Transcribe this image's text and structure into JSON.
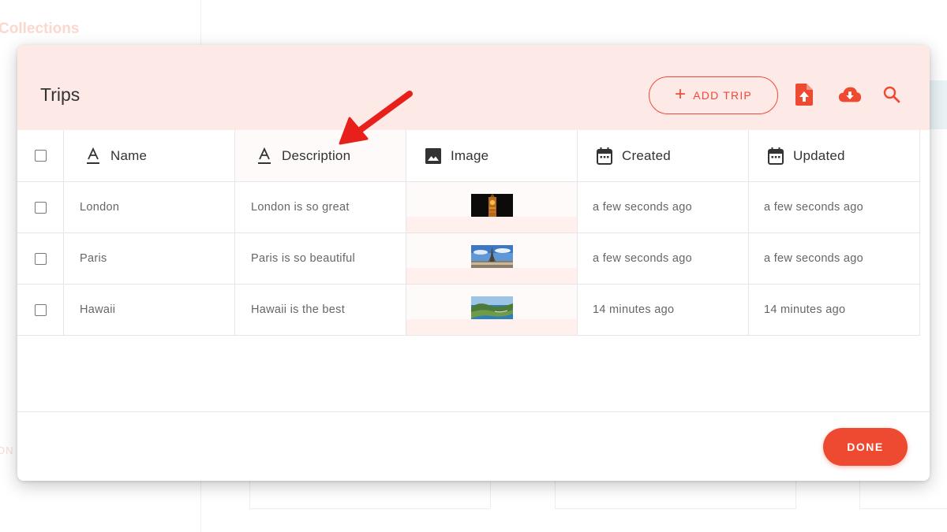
{
  "background": {
    "sidebar_title": "Collections",
    "faint_label": "ON"
  },
  "modal": {
    "title": "Trips",
    "add_button_label": "ADD TRIP",
    "done_button_label": "DONE"
  },
  "table": {
    "columns": [
      {
        "label": "Name",
        "icon": "text-format-icon"
      },
      {
        "label": "Description",
        "icon": "text-format-icon"
      },
      {
        "label": "Image",
        "icon": "image-icon"
      },
      {
        "label": "Created",
        "icon": "calendar-icon"
      },
      {
        "label": "Updated",
        "icon": "calendar-icon"
      }
    ],
    "rows": [
      {
        "name": "London",
        "description": "London is so great",
        "image": "big-ben-thumbnail",
        "created": "a few seconds ago",
        "updated": "a few seconds ago"
      },
      {
        "name": "Paris",
        "description": "Paris is so beautiful",
        "image": "eiffel-tower-thumbnail",
        "created": "a few seconds ago",
        "updated": "a few seconds ago"
      },
      {
        "name": "Hawaii",
        "description": "Hawaii is the best",
        "image": "hawaii-coast-thumbnail",
        "created": "14 minutes ago",
        "updated": "14 minutes ago"
      }
    ]
  },
  "colors": {
    "accent": "#ef4a3a",
    "header_bg": "#fde9e6",
    "annotation_arrow": "#e8201c"
  }
}
